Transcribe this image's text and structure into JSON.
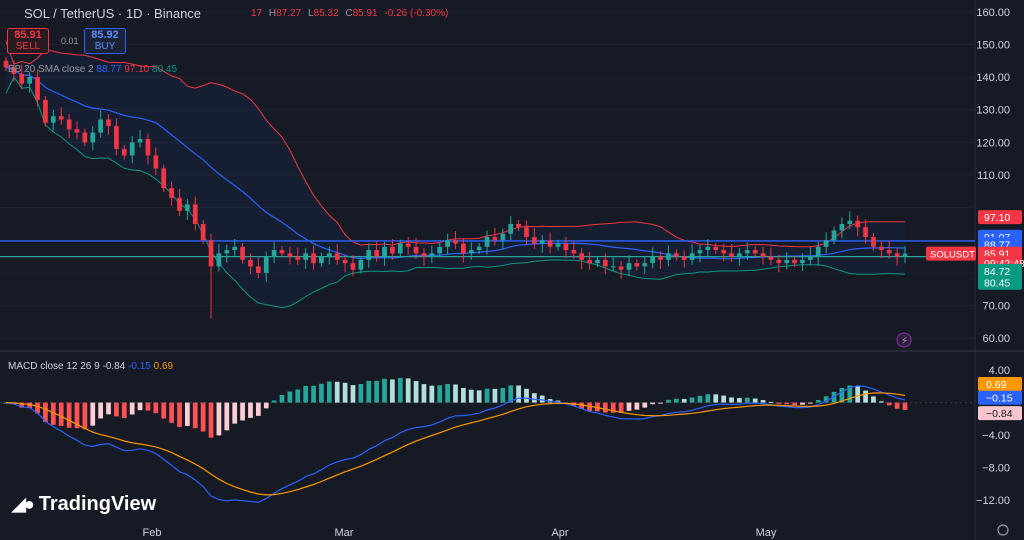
{
  "header": {
    "symbol_title": "SOL / TetherUS · 1D · Binance",
    "ohlc": [
      {
        "label": "",
        "value": "17"
      },
      {
        "label": "H",
        "value": "87.27"
      },
      {
        "label": "L",
        "value": "85.32"
      },
      {
        "label": "C",
        "value": "85.91"
      },
      {
        "label": "",
        "value": "-0.26 (-0.30%)"
      }
    ]
  },
  "trade": {
    "sell_price": "85.91",
    "sell_label": "SELL",
    "spread": "0.01",
    "buy_price": "85.92",
    "buy_label": "BUY"
  },
  "bb_legend": {
    "name": "BB 20 SMA close 2",
    "basis": "88.77",
    "upper": "97.10",
    "lower": "80.45"
  },
  "macd_legend": {
    "name": "MACD close 12 26 9",
    "histogram": "-0.84",
    "macd": "-0.15",
    "signal": "0.69"
  },
  "logo_text": "TradingView",
  "colors": {
    "background": "#161a25",
    "up": "#26a69a",
    "down": "#f23645",
    "bb_basis": "#2962ff",
    "bb_upper": "#f23645",
    "bb_lower": "#089981",
    "macd": "#2962ff",
    "signal": "#ff9800"
  },
  "chart_data": [
    {
      "type": "candlestick",
      "symbol": "SOLUSDT",
      "x_labels": [
        "Feb",
        "Mar",
        "Apr",
        "May"
      ],
      "y_ticks": [
        60,
        70,
        80,
        90,
        100,
        110,
        120,
        130,
        140,
        150,
        160
      ],
      "y_tick_labels": [
        "60.00",
        "70.00",
        "",
        "",
        "",
        "110.00",
        "120.00",
        "130.00",
        "140.00",
        "150.00",
        "160.00"
      ],
      "ylim": [
        57,
        163
      ],
      "price_labels": [
        {
          "text": "97.10",
          "value": 97.1,
          "color": "#f23645"
        },
        {
          "text": "91.07",
          "value": 91.07,
          "color": "#2962ff"
        },
        {
          "text": "88.77",
          "value": 88.77,
          "color": "#2962ff"
        },
        {
          "text": "85.91",
          "value": 85.91,
          "color": "#f23645"
        },
        {
          "text": "09:42:48",
          "value": 83.0,
          "color": "#f23645"
        },
        {
          "text": "84.72",
          "value": 80.6,
          "color": "#089981"
        },
        {
          "text": "80.45",
          "value": 77.0,
          "color": "#089981"
        }
      ],
      "symbol_tag": "SOLUSDT",
      "horizontal_lines": [
        {
          "value": 89.8,
          "color": "#2962ff"
        },
        {
          "value": 85.0,
          "color": "#26a69a"
        }
      ],
      "close_series": [
        143,
        141,
        138,
        140,
        133,
        126,
        128,
        127,
        124,
        123,
        120,
        123,
        127,
        125,
        118,
        116,
        120,
        121,
        116,
        112,
        106,
        103,
        99,
        101,
        95,
        90,
        82,
        86,
        87,
        88,
        84,
        82,
        80,
        85,
        87,
        86,
        85,
        84,
        86,
        83,
        85,
        86,
        84,
        83,
        81,
        84,
        87,
        85,
        88,
        86,
        89,
        88,
        86,
        85,
        86,
        88,
        90,
        89,
        86,
        87,
        88,
        91,
        90,
        92,
        95,
        94,
        91,
        89,
        90,
        88,
        89,
        87,
        86,
        84,
        83,
        84,
        82,
        82,
        81,
        83,
        82,
        83,
        85,
        84,
        86,
        85,
        84,
        86,
        87,
        88,
        87,
        86,
        85,
        86,
        87,
        86,
        85,
        84,
        83,
        84,
        83,
        84,
        85,
        88,
        90,
        93,
        95,
        96,
        94,
        91,
        88,
        87,
        86,
        85,
        85.91
      ]
    },
    {
      "type": "macd",
      "params": "12 26 9",
      "y_ticks": [
        4,
        0,
        -4,
        -8,
        -12
      ],
      "y_tick_labels": [
        "4.00",
        "",
        "−4.00",
        "−8.00",
        "−12.00"
      ],
      "ylim": [
        -14,
        6
      ],
      "value_labels": [
        {
          "text": "0.69",
          "value": 2.3,
          "color": "#ff9800"
        },
        {
          "text": "−0.15",
          "value": 0.6,
          "color": "#2962ff"
        },
        {
          "text": "−0.84",
          "value": -1.3,
          "color": "#f7c5cb"
        }
      ]
    }
  ]
}
